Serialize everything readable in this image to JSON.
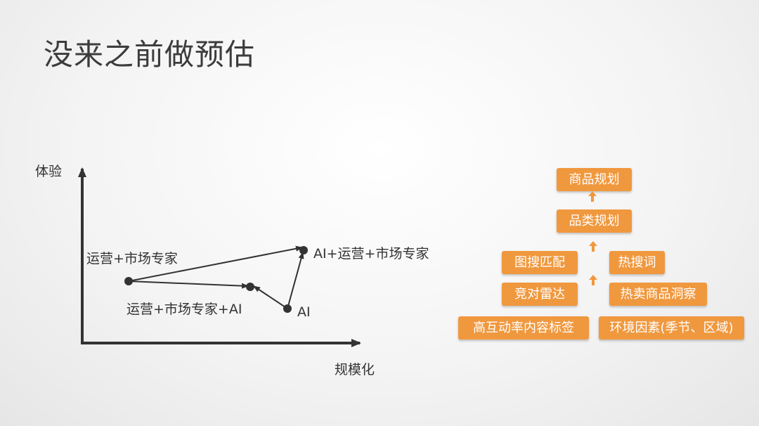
{
  "title": "没来之前做预估",
  "chart": {
    "y_axis_label": "体验",
    "x_axis_label": "规模化",
    "points": {
      "ops_market_expert": "运营+市场专家",
      "ops_market_expert_ai": "运营+市场专家+AI",
      "ai": "AI",
      "ai_ops_market_expert": "AI+运营+市场专家"
    }
  },
  "hierarchy": {
    "top": "商品规划",
    "second": "品类规划",
    "mid_left": [
      "图搜匹配",
      "竞对雷达"
    ],
    "mid_right": [
      "热搜词",
      "热卖商品洞察"
    ],
    "bottom_left": "高互动率内容标签",
    "bottom_right": "环境因素(季节、区域)"
  },
  "colors": {
    "box_fill": "#f0983e",
    "box_text": "#ffffff",
    "axis": "#333333"
  }
}
